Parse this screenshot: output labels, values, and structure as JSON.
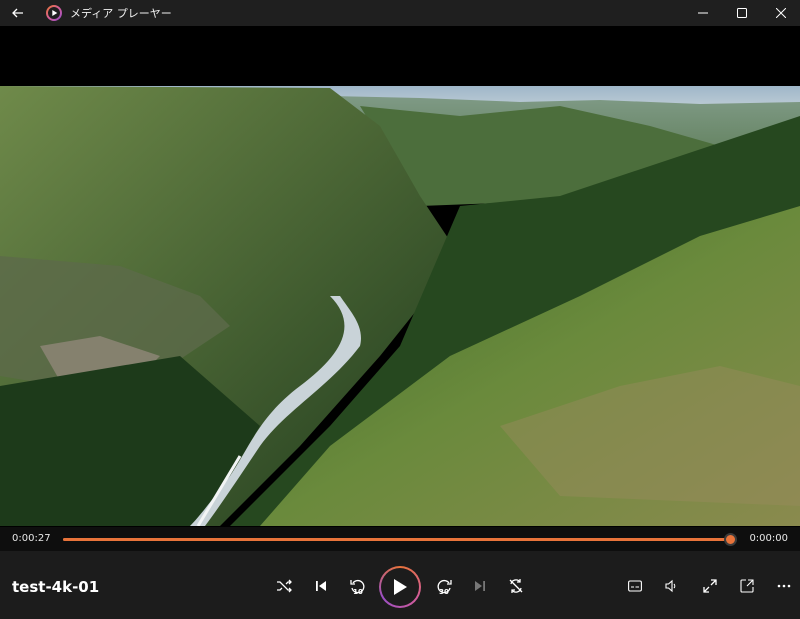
{
  "window": {
    "title": "メディア プレーヤー"
  },
  "player": {
    "current_time": "0:00:27",
    "total_time": "0:00:00",
    "progress": 0.998,
    "media_title": "test-4k-01",
    "skip_back_seconds": "10",
    "skip_forward_seconds": "30"
  },
  "colors": {
    "accent": "#e8733a",
    "titlebar": "#1f1f1f",
    "controlbar": "#1c1c1c"
  },
  "icons": {
    "back": "arrow-left-icon",
    "shuffle": "shuffle-icon",
    "previous": "previous-track-icon",
    "rewind": "rewind-10-icon",
    "play": "play-icon",
    "forward": "forward-30-icon",
    "next": "next-track-icon",
    "repeat": "repeat-off-icon",
    "subtitles": "subtitles-icon",
    "volume": "volume-icon",
    "fullscreen": "fullscreen-icon",
    "miniplayer": "miniplayer-icon",
    "more": "more-icon"
  }
}
